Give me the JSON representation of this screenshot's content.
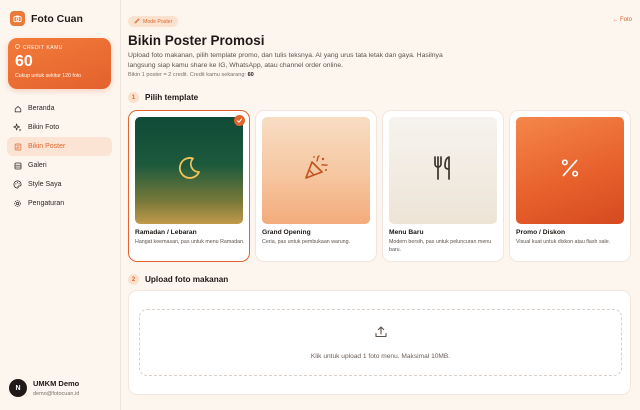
{
  "app": {
    "name": "Foto Cuan"
  },
  "credit": {
    "label": "CREDIT KAMU",
    "value": "60",
    "subtitle": "Cukup untuk sekitar 120 foto"
  },
  "nav": [
    {
      "label": "Beranda",
      "icon": "home-icon",
      "active": false
    },
    {
      "label": "Bikin Foto",
      "icon": "sparkle-icon",
      "active": false
    },
    {
      "label": "Bikin Poster",
      "icon": "poster-icon",
      "active": true
    },
    {
      "label": "Galeri",
      "icon": "gallery-icon",
      "active": false
    },
    {
      "label": "Style Saya",
      "icon": "palette-icon",
      "active": false
    },
    {
      "label": "Pengaturan",
      "icon": "gear-icon",
      "active": false
    }
  ],
  "user": {
    "initial": "N",
    "name": "UMKM Demo",
    "email": "demo@fotocuan.id"
  },
  "header": {
    "badge": "Mode Poster",
    "back": "← Foto",
    "title": "Bikin Poster Promosi",
    "description": "Upload foto makanan, pilih template promo, dan tulis teksnya. AI yang urus tata letak dan gaya. Hasilnya langsung siap kamu share ke IG, WhatsApp, atau channel order online.",
    "credit_note_prefix": "Bikin 1 poster = 2 credit. Credit kamu sekarang:",
    "credit_note_value": "60"
  },
  "steps": [
    {
      "number": "1",
      "label": "Pilih template"
    },
    {
      "number": "2",
      "label": "Upload foto makanan"
    }
  ],
  "templates": [
    {
      "name": "Ramadan / Lebaran",
      "description": "Hangat keemasan, pas untuk menu Ramadan.",
      "icon": "moon-icon",
      "selected": true
    },
    {
      "name": "Grand Opening",
      "description": "Ceria, pas untuk pembukaan warung.",
      "icon": "party-popper-icon",
      "selected": false
    },
    {
      "name": "Menu Baru",
      "description": "Modern bersih, pas untuk peluncuran menu baru.",
      "icon": "utensils-icon",
      "selected": false
    },
    {
      "name": "Promo / Diskon",
      "description": "Visual kuat untuk diskon atau flash sale.",
      "icon": "percent-icon",
      "selected": false
    }
  ],
  "upload": {
    "text": "Klik untuk upload 1 foto menu. Maksimal 10MB.",
    "icon": "upload-icon"
  },
  "colors": {
    "accent": "#e0652e",
    "background": "#fdf6ef"
  }
}
